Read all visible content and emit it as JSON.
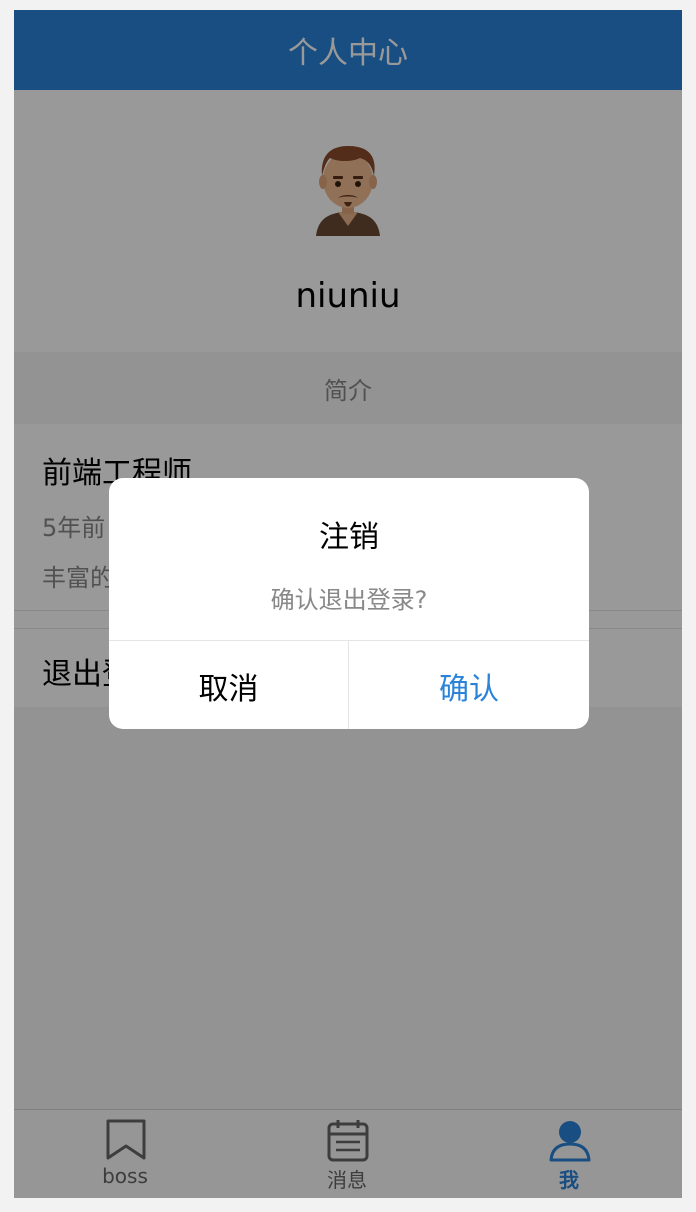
{
  "navbar": {
    "title": "个人中心"
  },
  "profile": {
    "username": "niuniu"
  },
  "intro": {
    "section_title": "简介",
    "title": "前端工程师",
    "line1": "5年前",
    "line2": "丰富的"
  },
  "logout_row": {
    "label": "退出登"
  },
  "dialog": {
    "title": "注销",
    "message": "确认退出登录?",
    "cancel_label": "取消",
    "confirm_label": "确认"
  },
  "tabbar": {
    "tabs": [
      {
        "label": "boss",
        "icon": "bookmark-icon",
        "active": false
      },
      {
        "label": "消息",
        "icon": "calendar-icon",
        "active": false
      },
      {
        "label": "我",
        "icon": "user-icon",
        "active": true
      }
    ]
  },
  "colors": {
    "accent": "#2a83d9",
    "overlay": "rgba(0,0,0,0.4)"
  }
}
